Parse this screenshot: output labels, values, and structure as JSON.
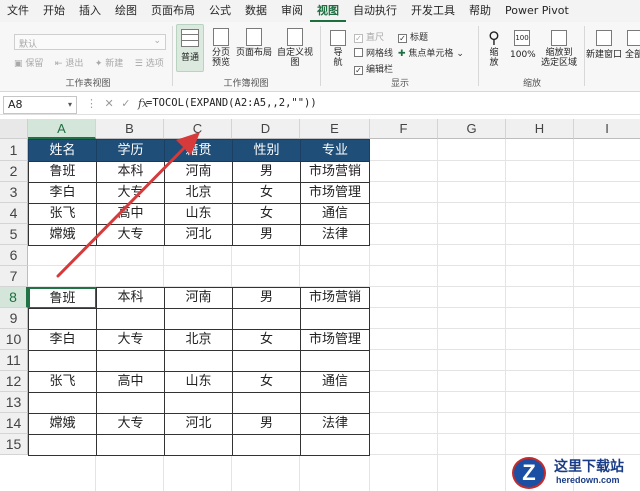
{
  "menu": {
    "items": [
      "文件",
      "开始",
      "插入",
      "绘图",
      "页面布局",
      "公式",
      "数据",
      "审阅",
      "视图",
      "自动执行",
      "开发工具",
      "帮助",
      "Power Pivot"
    ],
    "active_index": 8
  },
  "ribbon": {
    "sheet_view": {
      "dropdown_value": "默认",
      "keep": "保留",
      "exit": "退出",
      "new": "新建",
      "options": "选项",
      "title": "工作表视图"
    },
    "workbook_views": {
      "normal": "普通",
      "page_break_1": "分页",
      "page_break_2": "预览",
      "page_layout": "页面布局",
      "custom_views": "自定义视图",
      "title": "工作簿视图"
    },
    "show": {
      "navigation_1": "导",
      "navigation_2": "航",
      "ruler": "直尺",
      "gridlines": "网格线",
      "formula_bar": "编辑栏",
      "headings": "标题",
      "focus_cell": "焦点单元格",
      "title": "显示"
    },
    "zoom": {
      "zoom_1": "缩",
      "zoom_2": "放",
      "hundred": "100%",
      "to_selection_1": "缩放到",
      "to_selection_2": "选定区域",
      "title": "缩放"
    },
    "window": {
      "new_window": "新建窗口",
      "arrange_all": "全部"
    }
  },
  "formula_bar": {
    "name_box": "A8",
    "formula": "=TOCOL(EXPAND(A2:A5,,2,\"\"))"
  },
  "sheet": {
    "columns": [
      "A",
      "B",
      "C",
      "D",
      "E",
      "F",
      "G",
      "H",
      "I"
    ],
    "rows": [
      "1",
      "2",
      "3",
      "4",
      "5",
      "6",
      "7",
      "8",
      "9",
      "10",
      "11",
      "12",
      "13",
      "14",
      "15"
    ],
    "table1": {
      "headers": [
        "姓名",
        "学历",
        "籍贯",
        "性别",
        "专业"
      ],
      "rows": [
        [
          "鲁班",
          "本科",
          "河南",
          "男",
          "市场营销"
        ],
        [
          "李白",
          "大专",
          "北京",
          "女",
          "市场管理"
        ],
        [
          "张飞",
          "高中",
          "山东",
          "女",
          "通信"
        ],
        [
          "嫦娥",
          "大专",
          "河北",
          "男",
          "法律"
        ]
      ]
    },
    "table2": {
      "rows": [
        [
          "鲁班",
          "本科",
          "河南",
          "男",
          "市场营销"
        ],
        [
          "",
          "",
          "",
          "",
          ""
        ],
        [
          "李白",
          "大专",
          "北京",
          "女",
          "市场管理"
        ],
        [
          "",
          "",
          "",
          "",
          ""
        ],
        [
          "张飞",
          "高中",
          "山东",
          "女",
          "通信"
        ],
        [
          "",
          "",
          "",
          "",
          ""
        ],
        [
          "嫦娥",
          "大专",
          "河北",
          "男",
          "法律"
        ],
        [
          "",
          "",
          "",
          "",
          ""
        ]
      ]
    }
  },
  "watermark": {
    "logo_letter": "Z",
    "title": "这里下载站",
    "site": "heredown.com"
  },
  "colors": {
    "accent_green": "#217346",
    "header_fill": "#1f4e78",
    "arrow": "#d63a3a"
  }
}
